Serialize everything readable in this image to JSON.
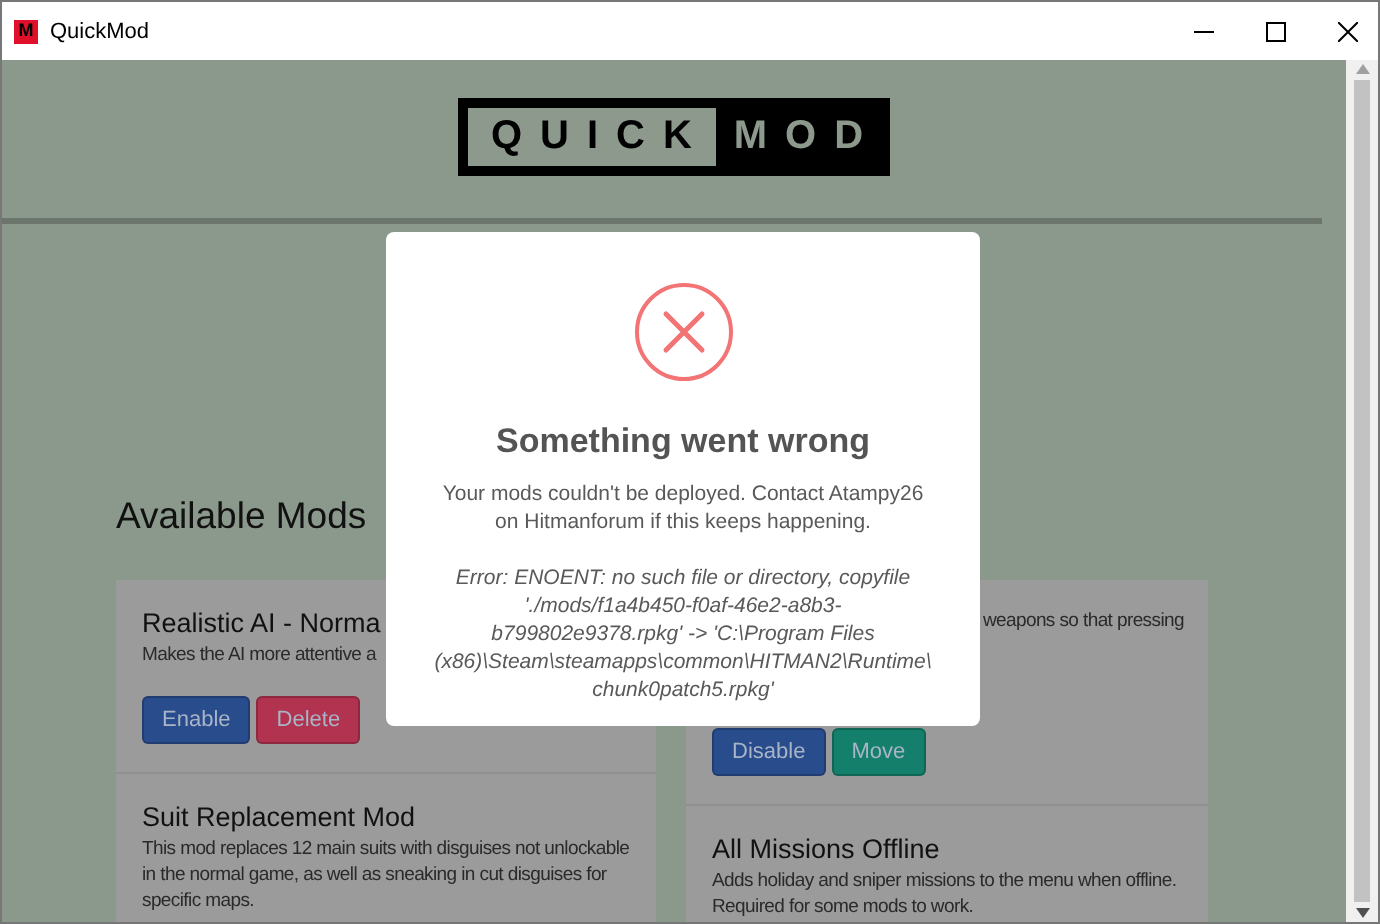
{
  "window": {
    "app_icon_letter": "M",
    "title": "QuickMod"
  },
  "logo": {
    "left": "QUICK",
    "right": "MOD"
  },
  "heading": "Available Mods",
  "columns": [
    [
      {
        "title": "Realistic AI - Norma",
        "description": "Makes the AI more attentive a",
        "buttons": [
          {
            "label": "Enable",
            "kind": "primary"
          },
          {
            "label": "Delete",
            "kind": "danger"
          }
        ]
      },
      {
        "title": "Suit Replacement Mod",
        "description": "This mod replaces 12 main suits with disguises not unlockable in the normal game, as well as sneaking in cut disguises for specific maps."
      }
    ],
    [
      {
        "description": "weapons so that pressing",
        "buttons": [
          {
            "label": "Disable",
            "kind": "primary"
          },
          {
            "label": "Move",
            "kind": "success"
          }
        ]
      },
      {
        "title": "All Missions Offline",
        "description": "Adds holiday and sniper missions to the menu when offline. Required for some mods to work."
      }
    ]
  ],
  "modal": {
    "title": "Something went wrong",
    "message": "Your mods couldn't be deployed. Contact Atampy26 on Hitmanforum if this keeps happening.",
    "error": "Error: ENOENT: no such file or directory, copyfile './mods/f1a4b450-f0af-46e2-a8b3-b799802e9378.rpkg' -> 'C:\\Program Files (x86)\\Steam\\steamapps\\common\\HITMAN2\\Runtime\\chunk0patch5.rpkg'"
  }
}
